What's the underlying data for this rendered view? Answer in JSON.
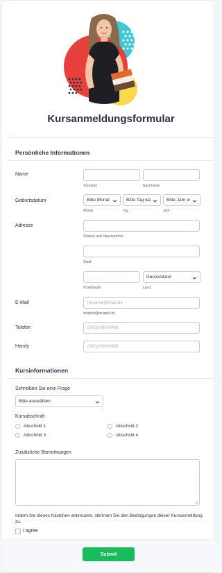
{
  "form": {
    "title": "Kursanmeldungsformular",
    "submit_label": "Submit"
  },
  "personal": {
    "section_title": "Persönliche Informationen",
    "name": {
      "label": "Name",
      "first_sub": "Vorname",
      "last_sub": "Nachname"
    },
    "birthdate": {
      "label": "Geburtsdatum",
      "month_value": "Bitte Monat",
      "day_value": "Bitte Tag wä",
      "year_value": "Bitte Jahr w",
      "month_sub": "Monat",
      "day_sub": "Tag",
      "year_sub": "Jahr"
    },
    "address": {
      "label": "Adresse",
      "street_sub": "Strasse und Hausnummer",
      "city_sub": "Stadt",
      "zip_sub": "Postleitzahl",
      "country_value": "Deutschland",
      "country_sub": "Land"
    },
    "email": {
      "label": "E-Mail",
      "placeholder": "ihrname@mail.de",
      "sub": "beispiel@beispiel.de"
    },
    "phone": {
      "label": "Telefon",
      "placeholder": "(000) 000-0000"
    },
    "mobile": {
      "label": "Handy",
      "placeholder": "(000) 000-0000"
    }
  },
  "course": {
    "section_title": "Kursinformationen",
    "question": {
      "label": "Schreiben Sie eine Frage",
      "value": "Bitte auswählen"
    },
    "section": {
      "label": "Kursabschnitt",
      "options": [
        "Abschnitt 1",
        "Abschnitt 2",
        "Abschnitt 3",
        "Abschnitt 4"
      ]
    },
    "remarks": {
      "label": "Zusätzliche Bemerkungen"
    },
    "terms": {
      "text": "Indem Sie dieses Kästchen ankreuzen, stimmen Sie den Bedingungen dieser Kursanmeldung zu.",
      "checkbox_label": "I agree"
    }
  },
  "colors": {
    "accent_green": "#18bd5b",
    "circle_red": "#e8403c",
    "circle_teal": "#3ec7d8",
    "circle_yellow": "#fcd94a",
    "dots_dark": "#2b2f3d"
  },
  "icons": [
    "student-illustration",
    "chevron-down-icon",
    "resize-grip-icon"
  ]
}
